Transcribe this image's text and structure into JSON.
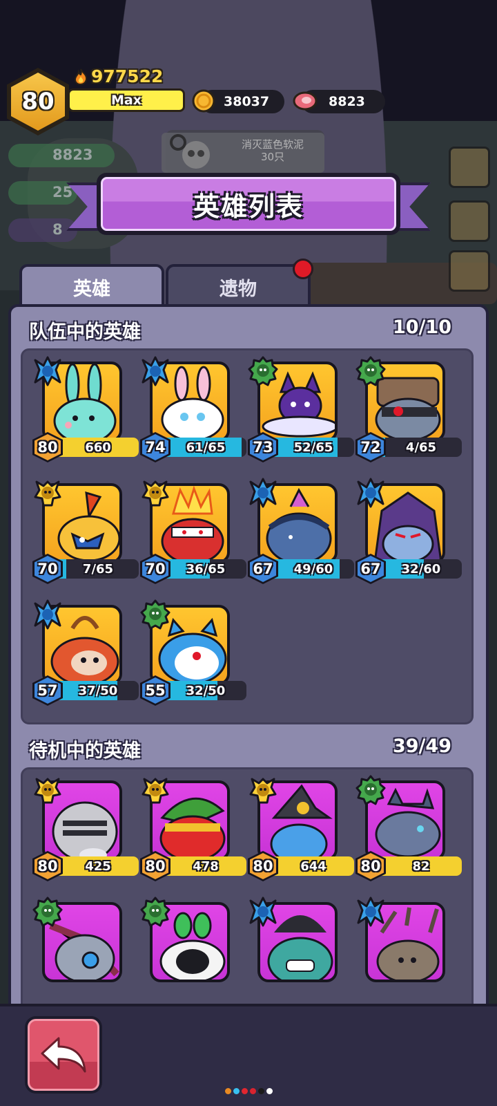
{
  "hud": {
    "level": "80",
    "power": "977522",
    "xp_label": "Max",
    "gold": "38037",
    "meat": "8823"
  },
  "background": {
    "side_meat": "8823",
    "side_wood": "25",
    "side_ore": "8",
    "quest_text": "消灭蓝色软泥\n30只"
  },
  "title": "英雄列表",
  "tabs": [
    {
      "label": "英雄",
      "active": true
    },
    {
      "label": "遗物",
      "active": false,
      "badge": true
    }
  ],
  "team": {
    "title": "队伍中的英雄",
    "count": "10/10",
    "heroes": [
      {
        "level": "80",
        "progress": "660",
        "fill": 1.0,
        "bar": "yellow",
        "lvl_color": "orange",
        "class": "blue-star",
        "frame": "gold",
        "art": "bunny"
      },
      {
        "level": "74",
        "progress": "61/65",
        "fill": 0.94,
        "bar": "cyan",
        "lvl_color": "blue",
        "class": "blue-star",
        "frame": "gold",
        "art": "pink-bunny"
      },
      {
        "level": "73",
        "progress": "52/65",
        "fill": 0.8,
        "bar": "cyan",
        "lvl_color": "blue",
        "class": "green-gear",
        "frame": "gold",
        "art": "ufo-cat"
      },
      {
        "level": "72",
        "progress": "4/65",
        "fill": 0.06,
        "bar": "cyan",
        "lvl_color": "blue",
        "class": "green-gear",
        "frame": "gold",
        "art": "robot"
      },
      {
        "level": "70",
        "progress": "7/65",
        "fill": 0.11,
        "bar": "cyan",
        "lvl_color": "blue",
        "class": "yellow-skull",
        "frame": "gold",
        "art": "bird"
      },
      {
        "level": "70",
        "progress": "36/65",
        "fill": 0.55,
        "bar": "cyan",
        "lvl_color": "blue",
        "class": "yellow-skull",
        "frame": "gold",
        "art": "fire-warrior"
      },
      {
        "level": "67",
        "progress": "49/60",
        "fill": 0.82,
        "bar": "cyan",
        "lvl_color": "blue",
        "class": "blue-star",
        "frame": "gold",
        "art": "squid"
      },
      {
        "level": "67",
        "progress": "32/60",
        "fill": 0.53,
        "bar": "cyan",
        "lvl_color": "blue",
        "class": "blue-star",
        "frame": "gold",
        "art": "hooded"
      },
      {
        "level": "57",
        "progress": "37/50",
        "fill": 0.74,
        "bar": "cyan",
        "lvl_color": "blue",
        "class": "blue-star",
        "frame": "gold",
        "art": "monkey"
      },
      {
        "level": "55",
        "progress": "32/50",
        "fill": 0.64,
        "bar": "cyan",
        "lvl_color": "blue",
        "class": "green-gear",
        "frame": "gold",
        "art": "doraemon"
      }
    ]
  },
  "standby": {
    "title": "待机中的英雄",
    "count": "39/49",
    "heroes": [
      {
        "level": "80",
        "progress": "425",
        "fill": 1.0,
        "bar": "yellow",
        "lvl_color": "orange",
        "class": "yellow-skull",
        "frame": "purple",
        "art": "knight"
      },
      {
        "level": "80",
        "progress": "478",
        "fill": 1.0,
        "bar": "yellow",
        "lvl_color": "orange",
        "class": "yellow-skull",
        "frame": "purple",
        "art": "ranger"
      },
      {
        "level": "80",
        "progress": "644",
        "fill": 1.0,
        "bar": "yellow",
        "lvl_color": "orange",
        "class": "yellow-skull",
        "frame": "purple",
        "art": "witch"
      },
      {
        "level": "80",
        "progress": "82",
        "fill": 1.0,
        "bar": "yellow",
        "lvl_color": "orange",
        "class": "green-gear",
        "frame": "purple",
        "art": "shark"
      },
      {
        "level": "",
        "progress": "",
        "fill": 0,
        "bar": "yellow",
        "lvl_color": "orange",
        "class": "green-gear",
        "frame": "purple",
        "art": "mecha"
      },
      {
        "level": "",
        "progress": "",
        "fill": 0,
        "bar": "yellow",
        "lvl_color": "orange",
        "class": "green-gear",
        "frame": "purple",
        "art": "sprout-bot"
      },
      {
        "level": "",
        "progress": "",
        "fill": 0,
        "bar": "yellow",
        "lvl_color": "orange",
        "class": "blue-star",
        "frame": "purple",
        "art": "dino"
      },
      {
        "level": "",
        "progress": "",
        "fill": 0,
        "bar": "yellow",
        "lvl_color": "orange",
        "class": "blue-star",
        "frame": "purple",
        "art": "root"
      }
    ]
  },
  "colors": {
    "panel": "#8d8aad",
    "inner": "#4f4c67",
    "title_purple": "#b35ed6",
    "back_button": "#d04a61",
    "xp_yellow": "#fff04a"
  },
  "pager_dots": [
    "#e98a22",
    "#39c1f0",
    "#e2262f",
    "#d9232f",
    "#1b1a1a",
    "#ffffff"
  ]
}
